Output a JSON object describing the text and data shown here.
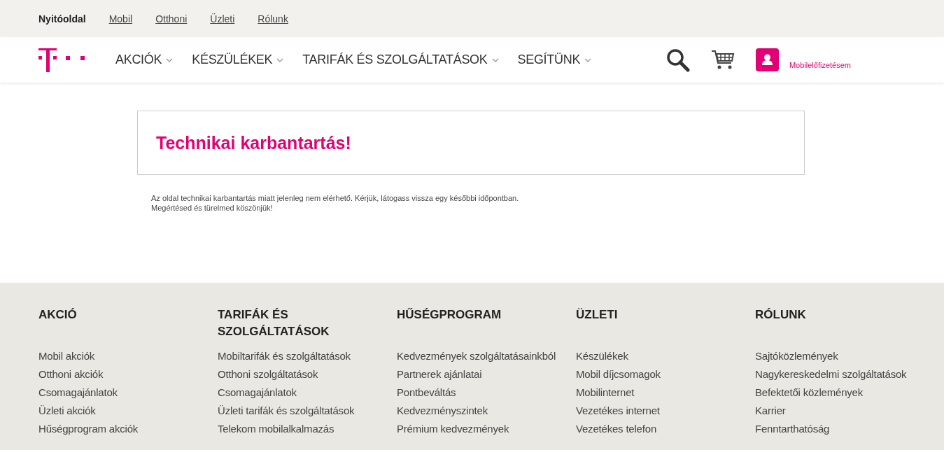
{
  "top_nav": [
    {
      "label": "Nyitóoldal",
      "selected": true
    },
    {
      "label": "Mobil",
      "selected": false
    },
    {
      "label": "Otthoni",
      "selected": false
    },
    {
      "label": "Üzleti",
      "selected": false
    },
    {
      "label": "Rólunk",
      "selected": false
    }
  ],
  "main_nav": [
    "AKCIÓK",
    "KÉSZÜLÉKEK",
    "TARIFÁK ÉS SZOLGÁLTATÁSOK",
    "SEGÍTÜNK"
  ],
  "account_link": "Mobilelőfizetésem",
  "notice": {
    "title": "Technikai karbantartás!",
    "lines": [
      "Az oldal technikai karbantartás miatt jelenleg nem elérhető. Kérjük, látogass vissza egy későbbi időpontban.",
      "Megértésed és türelmed köszönjük!"
    ]
  },
  "footer": [
    {
      "heading": "AKCIÓ",
      "links": [
        "Mobil akciók",
        "Otthoni akciók",
        "Csomagajánlatok",
        "Üzleti akciók",
        "Hűségprogram akciók"
      ]
    },
    {
      "heading": "TARIFÁK ÉS SZOLGÁLTATÁSOK",
      "links": [
        "Mobiltarifák és szolgáltatások",
        "Otthoni szolgáltatások",
        "Csomagajánlatok",
        "Üzleti tarifák és szolgáltatások",
        "Telekom mobilalkalmazás"
      ]
    },
    {
      "heading": "HŰSÉGPROGRAM",
      "links": [
        "Kedvezmények szolgáltatásainkból",
        "Partnerek ajánlatai",
        "Pontbeváltás",
        "Kedvezményszintek",
        "Prémium kedvezmények"
      ]
    },
    {
      "heading": "ÜZLETI",
      "links": [
        "Készülékek",
        "Mobil díjcsomagok",
        "Mobilinternet",
        "Vezetékes internet",
        "Vezetékes telefon"
      ]
    },
    {
      "heading": "RÓLUNK",
      "links": [
        "Sajtóközlemények",
        "Nagykereskedelmi szolgáltatások",
        "Befektetői közlemények",
        "Karrier",
        "Fenntarthatóság"
      ]
    }
  ]
}
